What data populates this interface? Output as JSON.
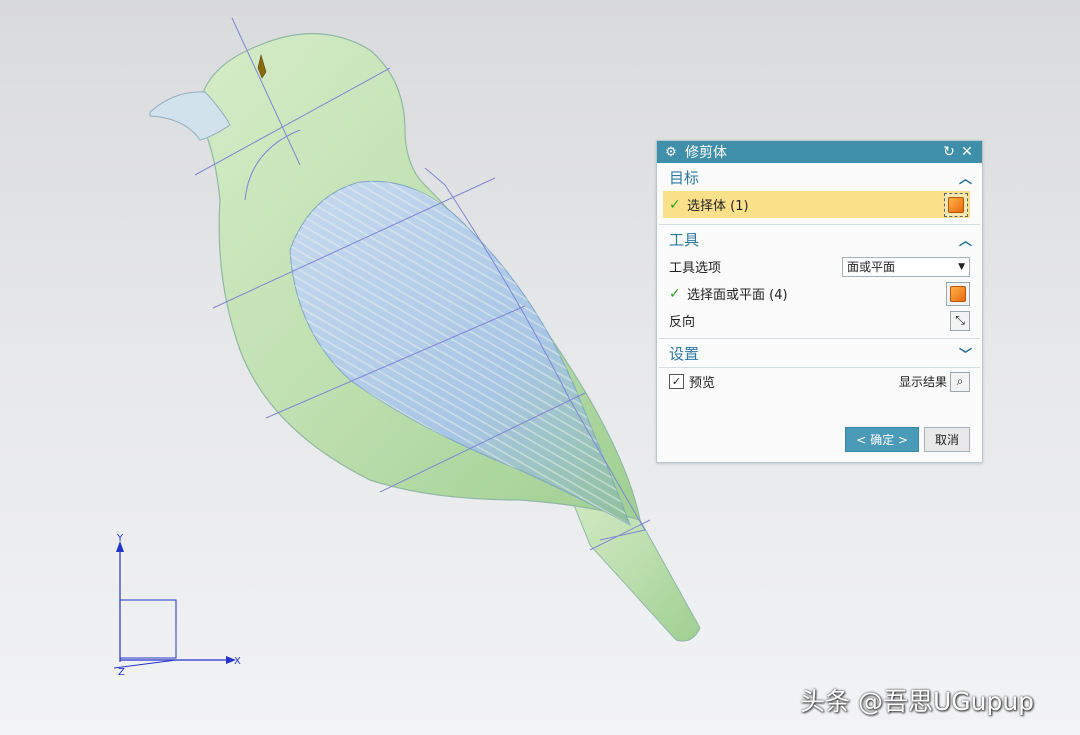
{
  "dialog": {
    "title": "修剪体",
    "sections": {
      "target": {
        "header": "目标",
        "select_body_label": "选择体 (1)"
      },
      "tool": {
        "header": "工具",
        "tool_option_label": "工具选项",
        "tool_option_value": "面或平面",
        "select_face_label": "选择面或平面 (4)",
        "reverse_label": "反向"
      },
      "settings": {
        "header": "设置"
      }
    },
    "preview_label": "预览",
    "show_result_label": "显示结果",
    "ok_label": "< 确定 >",
    "cancel_label": "取消"
  },
  "axes": {
    "y": "Y",
    "x": "X",
    "z": "Z"
  },
  "watermark": "头条 @吾思UGupup",
  "colors": {
    "titlebar": "#3f8faa",
    "selected_row": "#fbe08a",
    "model_green": "#bfe0b0",
    "model_blue_surface": "#a9c8e8"
  }
}
